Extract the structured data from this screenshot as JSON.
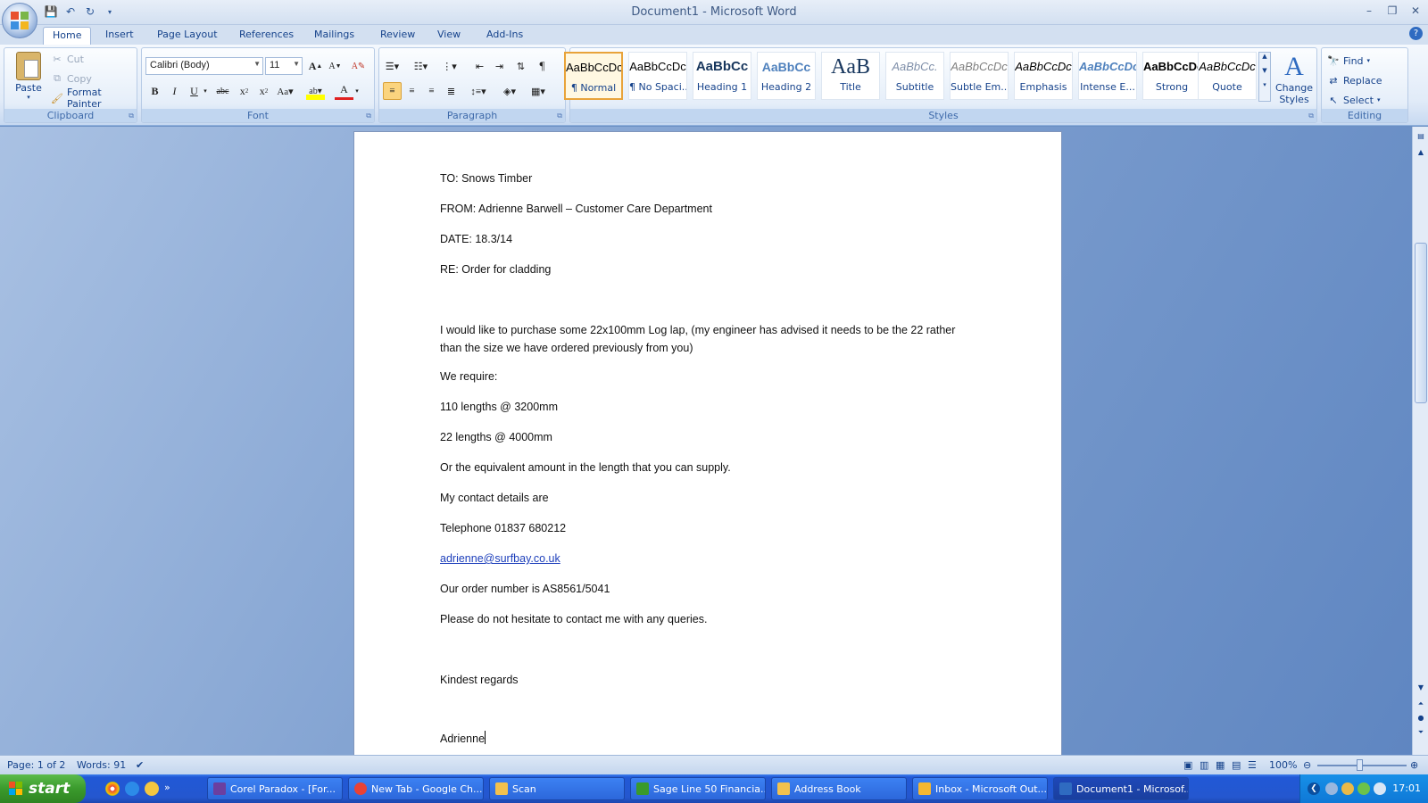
{
  "window": {
    "title": "Document1 - Microsoft Word",
    "controls": {
      "minimize": "–",
      "restore": "❐",
      "close": "✕"
    }
  },
  "ribbon_tabs": [
    "Home",
    "Insert",
    "Page Layout",
    "References",
    "Mailings",
    "Review",
    "View",
    "Add-Ins"
  ],
  "clipboard": {
    "paste": "Paste",
    "cut": "Cut",
    "copy": "Copy",
    "format_painter": "Format Painter",
    "label": "Clipboard"
  },
  "font": {
    "name": "Calibri (Body)",
    "size": "11",
    "label": "Font"
  },
  "paragraph": {
    "label": "Paragraph"
  },
  "styles": {
    "label": "Styles",
    "items": [
      {
        "sample": "AaBbCcDc",
        "name": "¶ Normal"
      },
      {
        "sample": "AaBbCcDc",
        "name": "¶ No Spaci..."
      },
      {
        "sample": "AaBbCc",
        "name": "Heading 1"
      },
      {
        "sample": "AaBbCc",
        "name": "Heading 2"
      },
      {
        "sample": "AaB",
        "name": "Title"
      },
      {
        "sample": "AaBbCc.",
        "name": "Subtitle"
      },
      {
        "sample": "AaBbCcDc",
        "name": "Subtle Em..."
      },
      {
        "sample": "AaBbCcDc",
        "name": "Emphasis"
      },
      {
        "sample": "AaBbCcDc",
        "name": "Intense E..."
      },
      {
        "sample": "AaBbCcDc",
        "name": "Strong"
      },
      {
        "sample": "AaBbCcDc",
        "name": "Quote"
      }
    ],
    "change_styles_line1": "Change",
    "change_styles_line2": "Styles"
  },
  "editing": {
    "find": "Find",
    "replace": "Replace",
    "select": "Select",
    "label": "Editing"
  },
  "document": {
    "lines": {
      "to": "TO: Snows Timber",
      "from": "FROM: Adrienne Barwell – Customer Care Department",
      "date": "DATE: 18.3/14",
      "re": "RE: Order for cladding",
      "body1": "I would like to purchase some 22x100mm Log lap, (my engineer has advised it needs to be the 22 rather than the size we have ordered previously from you)",
      "body2": "We require:",
      "item1": "110 lengths @ 3200mm",
      "item2": "22 lengths @ 4000mm",
      "body3": "Or the equivalent amount in the length that you can supply.",
      "body4": "My contact details are",
      "phone": "Telephone 01837 680212",
      "email": "adrienne@surfbay.co.uk",
      "order": "Our order number is AS8561/5041",
      "body5": "Please do not hesitate to contact me with any queries.",
      "closing": "Kindest regards",
      "signature": "Adrienne"
    }
  },
  "status_bar": {
    "page": "Page: 1 of 2",
    "words": "Words: 91",
    "zoom": "100%"
  },
  "taskbar": {
    "start": "start",
    "items": [
      {
        "label": "Corel Paradox - [For...",
        "color": "#6b3fa0"
      },
      {
        "label": "New Tab - Google Ch...",
        "color": "#e94235"
      },
      {
        "label": "Scan",
        "color": "#f2c14e"
      },
      {
        "label": "Sage Line 50 Financia...",
        "color": "#3a9a2c"
      },
      {
        "label": "Address Book",
        "color": "#f2c14e"
      },
      {
        "label": "Inbox - Microsoft Out...",
        "color": "#f5b731"
      },
      {
        "label": "Document1 - Microsof...",
        "color": "#2f6bc1"
      }
    ],
    "clock": "17:01"
  }
}
